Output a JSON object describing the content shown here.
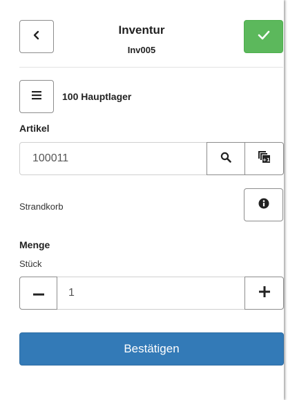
{
  "header": {
    "title": "Inventur",
    "subtitle": "Inv005"
  },
  "warehouse": {
    "label": "100 Hauptlager"
  },
  "article": {
    "section_label": "Artikel",
    "value": "100011",
    "description": "Strandkorb"
  },
  "quantity": {
    "section_label": "Menge",
    "unit": "Stück",
    "value": "1"
  },
  "actions": {
    "confirm_label": "Bestätigen"
  },
  "colors": {
    "confirm_green": "#5cb85c",
    "primary_blue": "#337ab7"
  },
  "icons": {
    "back": "chevron-left-icon",
    "confirm": "check-icon",
    "menu": "hamburger-icon",
    "search": "search-icon",
    "copy_plus": "copy-plus-one-icon",
    "info": "info-icon",
    "minus": "minus-icon",
    "plus": "plus-icon"
  }
}
